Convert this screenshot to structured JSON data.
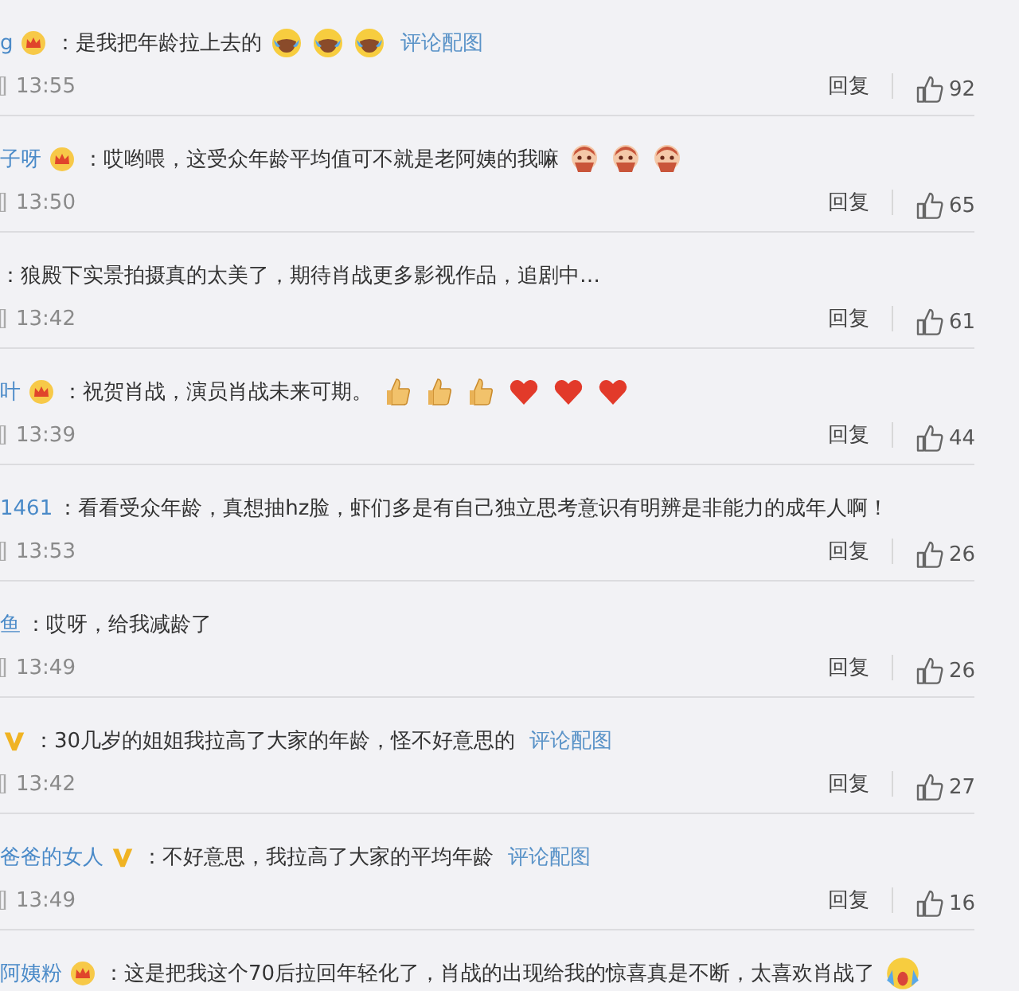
{
  "comments": [
    {
      "user": "g",
      "badge": {
        "kind": "crown"
      },
      "text": "：是我把年龄拉上去的",
      "emojis": [
        {
          "kind": "laugh-cry"
        },
        {
          "kind": "laugh-cry"
        },
        {
          "kind": "laugh-cry"
        }
      ],
      "link": "评论配图",
      "time": "13:55",
      "reply": "回复",
      "likes": "92"
    },
    {
      "user": "子呀",
      "badge": {
        "kind": "crown"
      },
      "text": "：哎哟喂，这受众年龄平均值可不就是老阿姨的我嘛",
      "emojis": [
        {
          "kind": "blush-face"
        },
        {
          "kind": "blush-face"
        },
        {
          "kind": "blush-face"
        }
      ],
      "time": "13:50",
      "reply": "回复",
      "likes": "65"
    },
    {
      "text": "：狼殿下实景拍摄真的太美了，期待肖战更多影视作品，追剧中…",
      "time": "13:42",
      "reply": "回复",
      "likes": "61"
    },
    {
      "user": "叶",
      "badge": {
        "kind": "crown"
      },
      "text": "：祝贺肖战，演员肖战未来可期。",
      "emojis": [
        {
          "kind": "thumbs-up"
        },
        {
          "kind": "thumbs-up"
        },
        {
          "kind": "thumbs-up"
        },
        {
          "kind": "heart"
        },
        {
          "kind": "heart"
        },
        {
          "kind": "heart"
        }
      ],
      "time": "13:39",
      "reply": "回复",
      "likes": "44"
    },
    {
      "user": "1461",
      "text": "：看看受众年龄，真想抽hz脸，虾们多是有自己独立思考意识有明辨是非能力的成年人啊！",
      "time": "13:53",
      "reply": "回复",
      "likes": "26"
    },
    {
      "user": "鱼",
      "text": "：哎呀，给我减龄了",
      "time": "13:49",
      "reply": "回复",
      "likes": "26"
    },
    {
      "badge": {
        "kind": "vip"
      },
      "text": "：30几岁的姐姐我拉高了大家的年龄，怪不好意思的",
      "link": "评论配图",
      "time": "13:42",
      "reply": "回复",
      "likes": "27"
    },
    {
      "user": "爸爸的女人",
      "badge": {
        "kind": "vip"
      },
      "text": "：不好意思，我拉高了大家的平均年龄",
      "link": "评论配图",
      "time": "13:49",
      "reply": "回复",
      "likes": "16"
    },
    {
      "user": "阿姨粉",
      "badge": {
        "kind": "crown"
      },
      "text": "：这是把我这个70后拉回年轻化了，肖战的出现给我的惊喜真是不断，太喜欢肖战了",
      "emojis": [
        {
          "kind": "scream-face"
        }
      ]
    }
  ]
}
